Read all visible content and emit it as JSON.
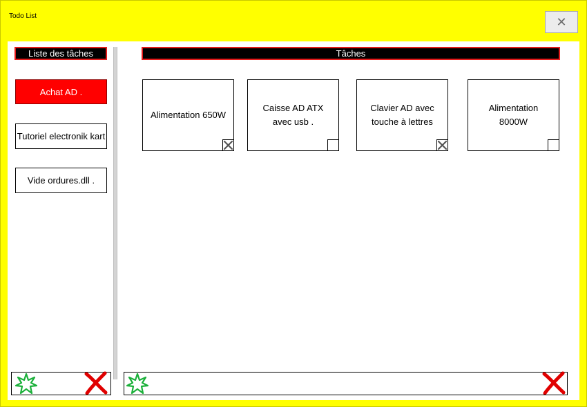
{
  "window": {
    "title": "Todo List",
    "close_glyph": "✕"
  },
  "categories_panel": {
    "header": "Liste des tâches",
    "items": [
      {
        "label": "Achat AD .",
        "active": true
      },
      {
        "label": "Tutoriel electronik kart",
        "active": false
      },
      {
        "label": "Vide ordures.dll .",
        "active": false
      }
    ]
  },
  "tasks_panel": {
    "header": "Tâches",
    "tasks": [
      {
        "label": "Alimentation 650W",
        "done": true
      },
      {
        "label": "Caisse AD ATX avec usb .",
        "done": false
      },
      {
        "label": "Clavier AD avec touche à lettres",
        "done": true
      },
      {
        "label": "Alimentation 8000W",
        "done": false
      }
    ]
  },
  "icons": {
    "add": "green-star-add-icon",
    "delete": "red-x-delete-icon",
    "close": "close-icon",
    "check": "checkbox-x-icon"
  },
  "colors": {
    "window_bg": "#ffff00",
    "header_bg": "#000000",
    "header_border": "#e41a1a",
    "active_category": "#ff0000",
    "add_icon": "#1bb03a",
    "delete_icon": "#e00000"
  }
}
